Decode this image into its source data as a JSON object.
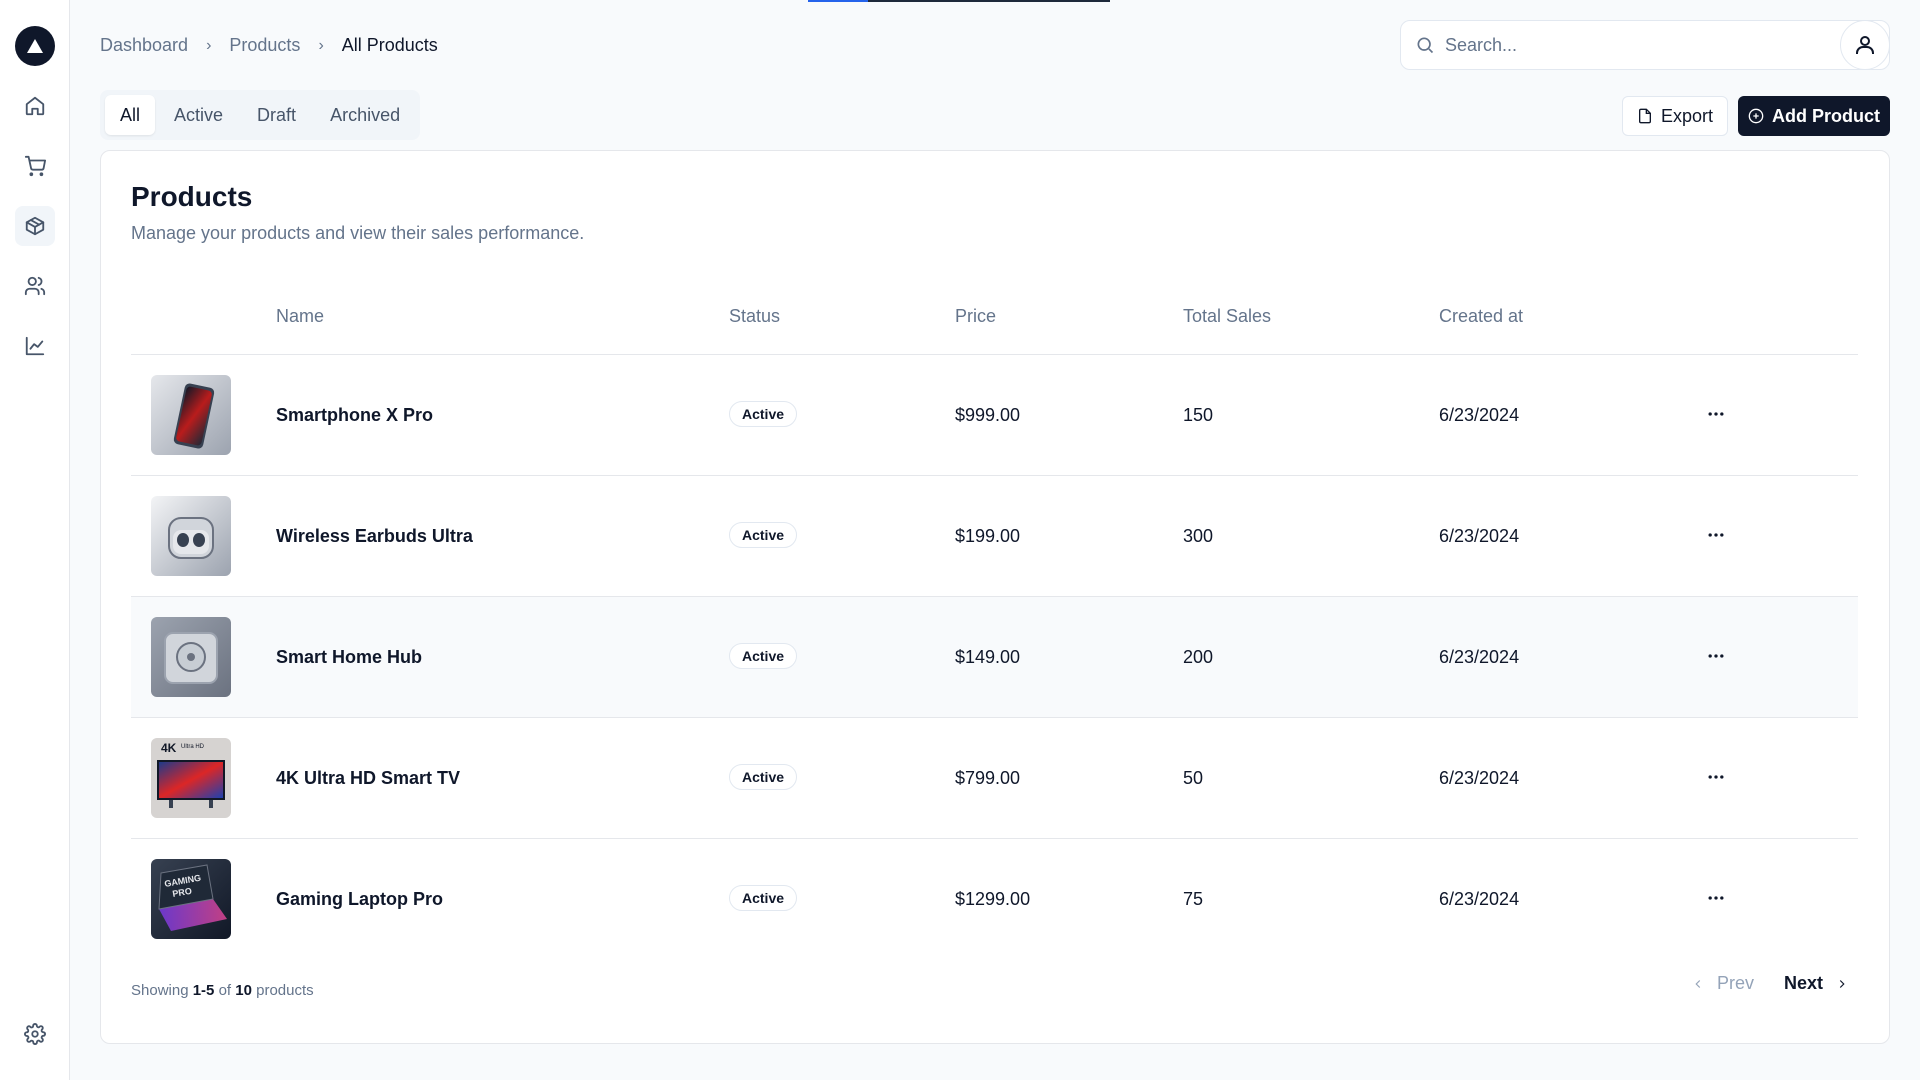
{
  "breadcrumb": {
    "items": [
      "Dashboard",
      "Products",
      "All Products"
    ]
  },
  "search": {
    "placeholder": "Search..."
  },
  "tabs": [
    "All",
    "Active",
    "Draft",
    "Archived"
  ],
  "actions": {
    "export_label": "Export",
    "add_label": "Add Product"
  },
  "card": {
    "title": "Products",
    "description": "Manage your products and view their sales performance."
  },
  "table": {
    "headers": {
      "name": "Name",
      "status": "Status",
      "price": "Price",
      "sales": "Total Sales",
      "created": "Created at"
    },
    "rows": [
      {
        "name": "Smartphone X Pro",
        "status": "Active",
        "price": "$999.00",
        "sales": "150",
        "created": "6/23/2024"
      },
      {
        "name": "Wireless Earbuds Ultra",
        "status": "Active",
        "price": "$199.00",
        "sales": "300",
        "created": "6/23/2024"
      },
      {
        "name": "Smart Home Hub",
        "status": "Active",
        "price": "$149.00",
        "sales": "200",
        "created": "6/23/2024"
      },
      {
        "name": "4K Ultra HD Smart TV",
        "status": "Active",
        "price": "$799.00",
        "sales": "50",
        "created": "6/23/2024"
      },
      {
        "name": "Gaming Laptop Pro",
        "status": "Active",
        "price": "$1299.00",
        "sales": "75",
        "created": "6/23/2024"
      }
    ]
  },
  "footer": {
    "showing_prefix": "Showing",
    "range": "1-5",
    "of": "of",
    "total": "10",
    "suffix": "products"
  },
  "pagination": {
    "prev": "Prev",
    "next": "Next"
  },
  "thumbnails": {
    "tv_label": "4K",
    "tv_sub_label": "Ultra HD",
    "laptop_label": "GAMING",
    "laptop_sub_label": "PRO"
  },
  "icons": {
    "sidebar": [
      "home-icon",
      "cart-icon",
      "package-icon",
      "users-icon",
      "chart-icon"
    ],
    "settings": "gear-icon",
    "search": "search-icon",
    "avatar": "user-icon"
  },
  "colors": {
    "primary": "#0f172a",
    "muted": "#64748b",
    "accent": "#2563eb",
    "border": "#e5e7eb"
  }
}
